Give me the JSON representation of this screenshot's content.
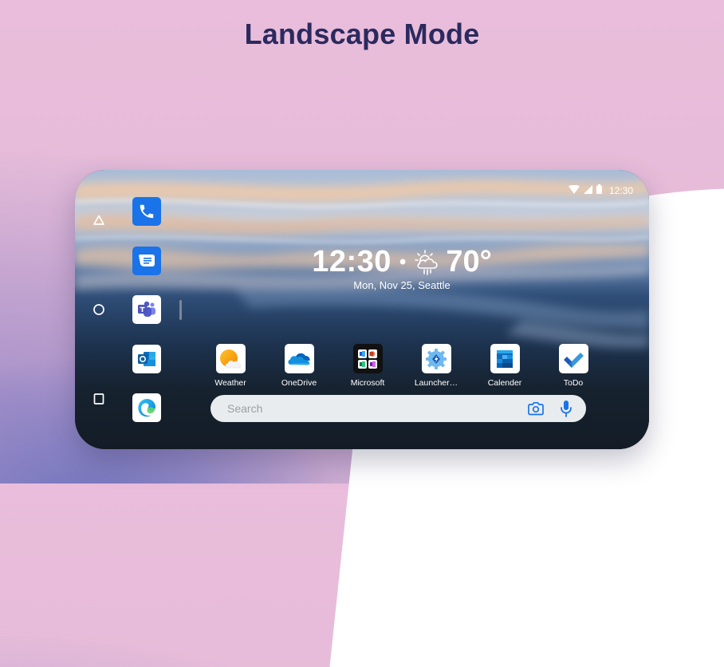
{
  "page": {
    "title": "Landscape Mode"
  },
  "status_bar": {
    "time": "12:30",
    "icons": [
      "wifi-icon",
      "cell-signal-icon",
      "battery-icon"
    ]
  },
  "nav_buttons": [
    {
      "name": "back",
      "icon": "triangle-icon"
    },
    {
      "name": "home",
      "icon": "circle-icon"
    },
    {
      "name": "recents",
      "icon": "square-icon"
    }
  ],
  "dock": [
    {
      "name": "Phone",
      "icon": "phone-icon",
      "color": "#1a73e8"
    },
    {
      "name": "Messages",
      "icon": "message-icon",
      "color": "#1a73e8"
    },
    {
      "name": "Teams",
      "icon": "teams-icon",
      "color": "#5059c9"
    },
    {
      "name": "Outlook",
      "icon": "outlook-icon",
      "color": "#0f6cbd"
    },
    {
      "name": "Edge",
      "icon": "edge-icon",
      "color": "#1b9de2"
    }
  ],
  "clock_widget": {
    "time": "12:30",
    "separator": "•",
    "weather_icon": "partly-cloudy-rain-icon",
    "temperature": "70°",
    "date_location": "Mon, Nov 25, Seattle"
  },
  "apps": [
    {
      "label": "Weather",
      "icon": "weather-icon"
    },
    {
      "label": "OneDrive",
      "icon": "onedrive-icon"
    },
    {
      "label": "Microsoft",
      "icon": "microsoft-office-icon"
    },
    {
      "label": "Launcher…",
      "icon": "launcher-icon"
    },
    {
      "label": "Calender",
      "icon": "calendar-icon"
    },
    {
      "label": "ToDo",
      "icon": "todo-icon"
    }
  ],
  "search": {
    "placeholder": "Search",
    "value": ""
  },
  "colors": {
    "title": "#2b2a5e",
    "accent": "#1a73e8",
    "search_bg": "#e9ecee"
  }
}
